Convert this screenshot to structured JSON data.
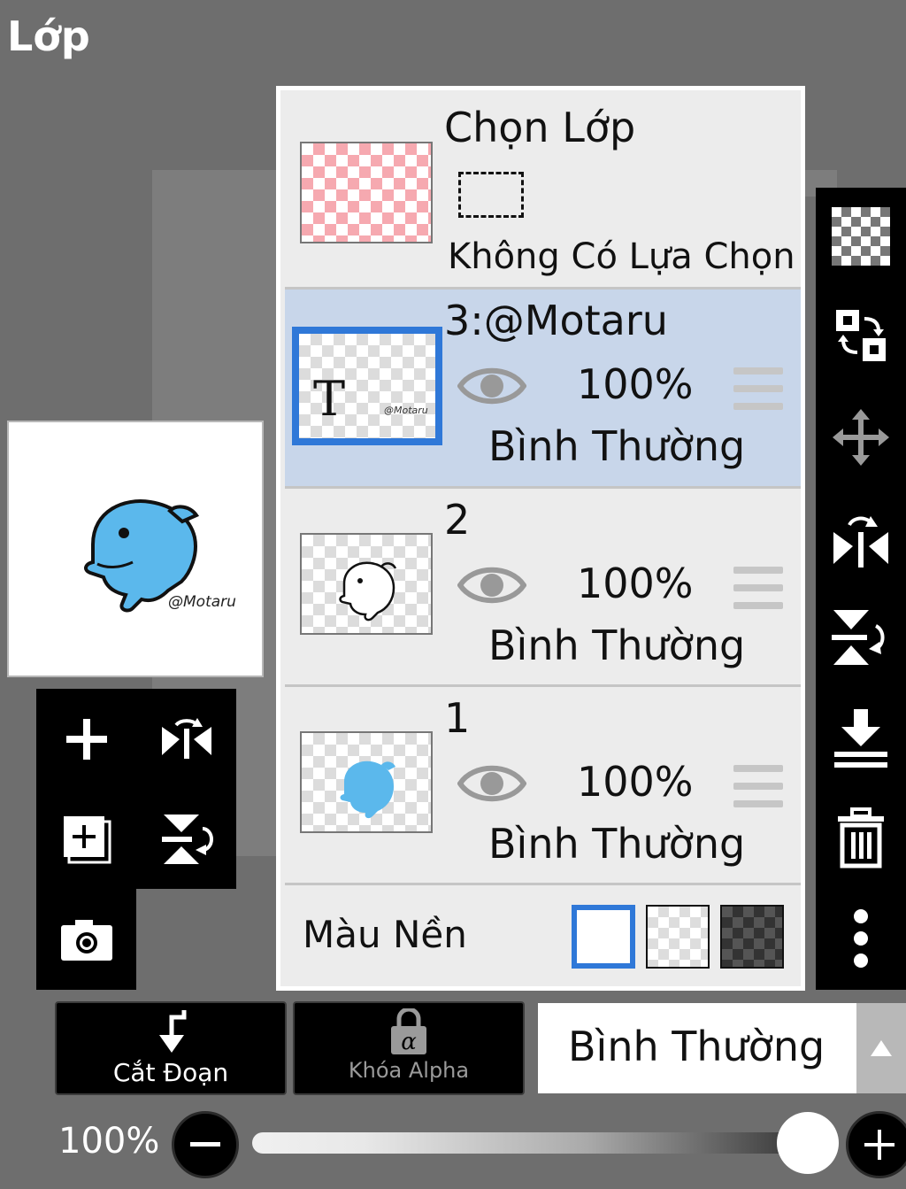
{
  "header": {
    "title": "Lớp"
  },
  "preview": {
    "watermark": "@Motaru"
  },
  "selection": {
    "title": "Chọn Lớp",
    "status": "Không Có Lựa Chọn"
  },
  "layers": [
    {
      "name": "3:@Motaru",
      "opacity": "100%",
      "mode": "Bình Thường",
      "thumb_text": "T",
      "thumb_sig": "@Motaru"
    },
    {
      "name": "2",
      "opacity": "100%",
      "mode": "Bình Thường"
    },
    {
      "name": "1",
      "opacity": "100%",
      "mode": "Bình Thường"
    }
  ],
  "background": {
    "label": "Màu Nền"
  },
  "bottom": {
    "clip_label": "Cắt Đoạn",
    "alpha_label": "Khóa Alpha",
    "blend_mode": "Bình Thường"
  },
  "opacity_bar": {
    "value_label": "100%",
    "value": 1.0
  },
  "colors": {
    "accent": "#2f78d8",
    "active_row": "#c8d6ea",
    "dolphin": "#5bb8ec"
  }
}
